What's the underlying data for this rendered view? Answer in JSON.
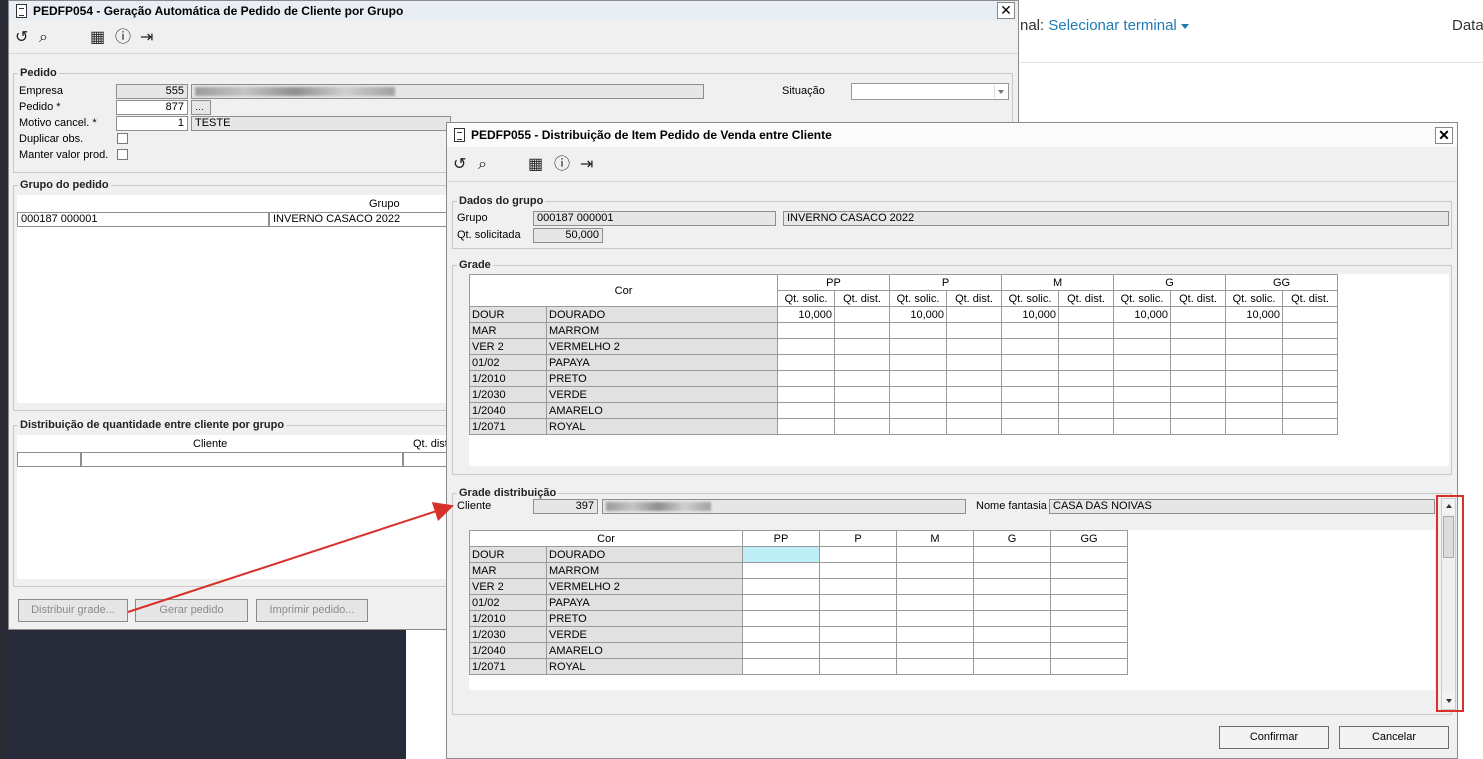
{
  "background": {
    "terminal_prefix": "nal: ",
    "terminal_link": "Selecionar terminal",
    "data_label": "Data"
  },
  "main": {
    "title": "PEDFP054 - Geração Automática de Pedido de Cliente por Grupo",
    "close": "✕",
    "pedido": {
      "legend": "Pedido",
      "empresa_label": "Empresa",
      "empresa_value": "555",
      "pedido_label": "Pedido *",
      "pedido_value": "877",
      "motivo_label": "Motivo cancel. *",
      "motivo_value": "1",
      "motivo_desc": "TESTE",
      "duplicar_label": "Duplicar obs.",
      "manter_label": "Manter valor prod.",
      "situacao_label": "Situação"
    },
    "grupo": {
      "legend": "Grupo do pedido",
      "col_grupo": "Grupo",
      "row_code": "000187 000001",
      "row_name": "INVERNO CASACO 2022"
    },
    "distribuicao": {
      "legend": "Distribuição de quantidade entre cliente por grupo",
      "col_cliente": "Cliente",
      "col_qt": "Qt. dist"
    },
    "buttons": {
      "distribuir": "Distribuir grade...",
      "gerar": "Gerar pedido",
      "imprimir": "Imprimir pedido..."
    }
  },
  "dialog": {
    "title": "PEDFP055 - Distribuição de Item Pedido de Venda entre Cliente",
    "close": "✕",
    "dados": {
      "legend": "Dados do grupo",
      "grupo_label": "Grupo",
      "grupo_code": "000187 000001",
      "grupo_name": "INVERNO CASACO 2022",
      "qt_label": "Qt. solicitada",
      "qt_value": "50,000"
    },
    "grade": {
      "legend": "Grade",
      "cor_header": "Cor",
      "sizes": [
        "PP",
        "P",
        "M",
        "G",
        "GG"
      ],
      "sub_solic": "Qt. solic.",
      "sub_dist": "Qt. dist.",
      "rows": [
        {
          "code": "DOUR",
          "desc": "DOURADO",
          "values": [
            "10,000",
            "",
            "10,000",
            "",
            "10,000",
            "",
            "10,000",
            "",
            "10,000",
            ""
          ]
        },
        {
          "code": "MAR",
          "desc": "MARROM",
          "values": [
            "",
            "",
            "",
            "",
            "",
            "",
            "",
            "",
            "",
            ""
          ]
        },
        {
          "code": "VER 2",
          "desc": "VERMELHO 2",
          "values": [
            "",
            "",
            "",
            "",
            "",
            "",
            "",
            "",
            "",
            ""
          ]
        },
        {
          "code": "01/02",
          "desc": "PAPAYA",
          "values": [
            "",
            "",
            "",
            "",
            "",
            "",
            "",
            "",
            "",
            ""
          ]
        },
        {
          "code": "1/2010",
          "desc": "PRETO",
          "values": [
            "",
            "",
            "",
            "",
            "",
            "",
            "",
            "",
            "",
            ""
          ]
        },
        {
          "code": "1/2030",
          "desc": "VERDE",
          "values": [
            "",
            "",
            "",
            "",
            "",
            "",
            "",
            "",
            "",
            ""
          ]
        },
        {
          "code": "1/2040",
          "desc": "AMARELO",
          "values": [
            "",
            "",
            "",
            "",
            "",
            "",
            "",
            "",
            "",
            ""
          ]
        },
        {
          "code": "1/2071",
          "desc": "ROYAL",
          "values": [
            "",
            "",
            "",
            "",
            "",
            "",
            "",
            "",
            "",
            ""
          ]
        }
      ]
    },
    "grade_dist": {
      "legend": "Grade distribuição",
      "cliente_label": "Cliente",
      "cliente_code": "397",
      "fantasia_label": "Nome fantasia",
      "fantasia_value": "CASA DAS NOIVAS",
      "cor_header": "Cor",
      "sizes": [
        "PP",
        "P",
        "M",
        "G",
        "GG"
      ],
      "rows": [
        {
          "code": "DOUR",
          "desc": "DOURADO"
        },
        {
          "code": "MAR",
          "desc": "MARROM"
        },
        {
          "code": "VER 2",
          "desc": "VERMELHO 2"
        },
        {
          "code": "01/02",
          "desc": "PAPAYA"
        },
        {
          "code": "1/2010",
          "desc": "PRETO"
        },
        {
          "code": "1/2030",
          "desc": "VERDE"
        },
        {
          "code": "1/2040",
          "desc": "AMARELO"
        },
        {
          "code": "1/2071",
          "desc": "ROYAL"
        }
      ]
    },
    "buttons": {
      "confirmar": "Confirmar",
      "cancelar": "Cancelar"
    }
  },
  "colors": {
    "annotation": "#d9302b",
    "selected_cell": "#bdeef6",
    "link": "#1f7ab4"
  }
}
